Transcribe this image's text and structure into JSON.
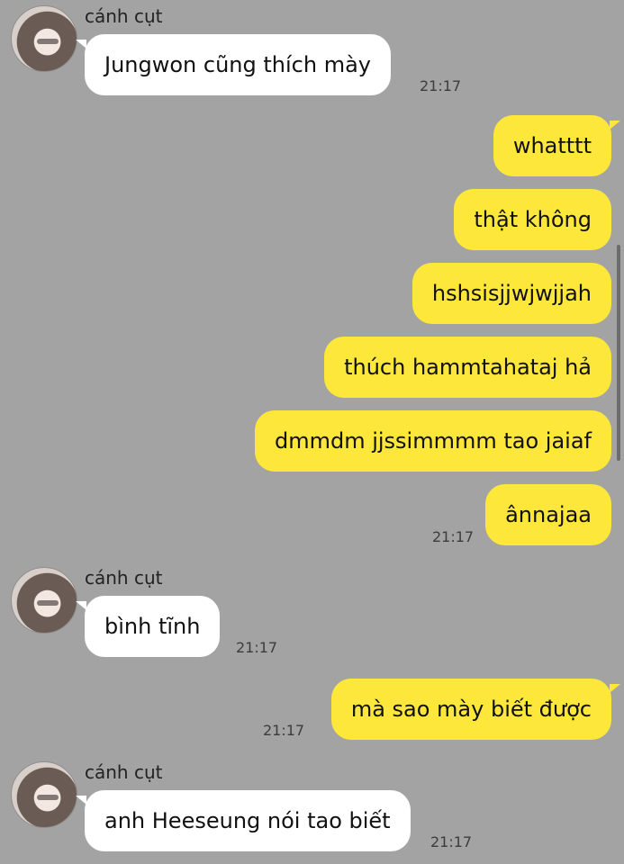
{
  "sender": "cánh cụt",
  "messages": [
    {
      "text": "Jungwon cũng thích mày",
      "time": "21:17"
    },
    {
      "text": "whatttt"
    },
    {
      "text": "thật không"
    },
    {
      "text": "hshsisjjwjwjjah"
    },
    {
      "text": "thúch hammtahataj hả"
    },
    {
      "text": "dmmdm jjssimmmm tao jaiaf"
    },
    {
      "text": "ânnajaa",
      "time": "21:17"
    },
    {
      "text": "bình tĩnh",
      "time": "21:17"
    },
    {
      "text": "mà sao mày biết được",
      "time": "21:17"
    },
    {
      "text": "anh Heeseung nói tao biết",
      "time": "21:17"
    }
  ]
}
